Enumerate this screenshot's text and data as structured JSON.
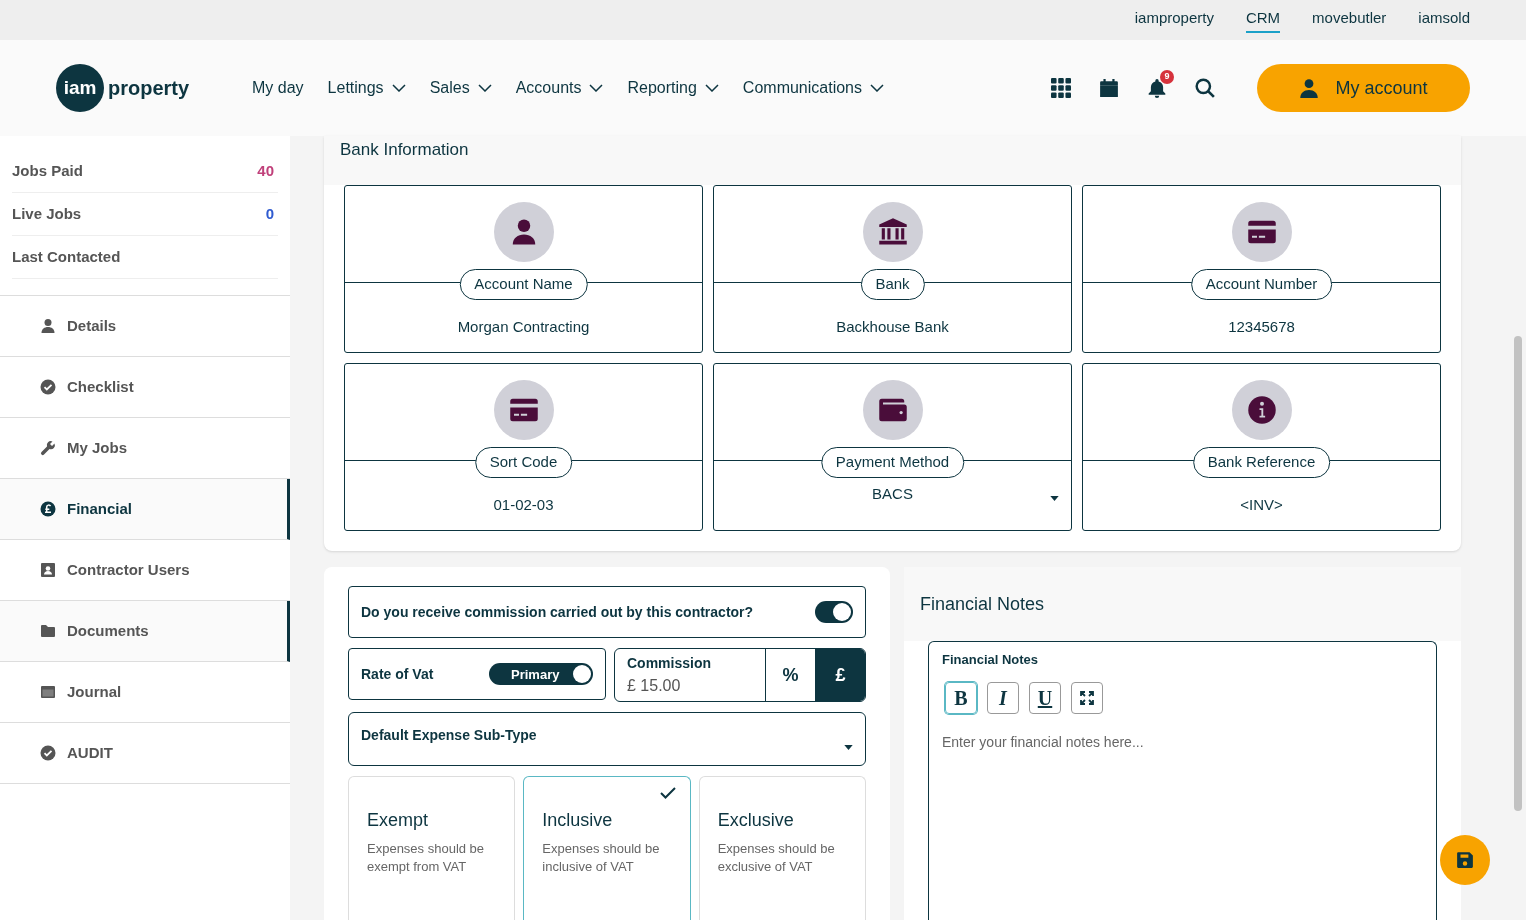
{
  "top_links": [
    {
      "label": "iamproperty",
      "selected": false
    },
    {
      "label": "CRM",
      "selected": true
    },
    {
      "label": "movebutler",
      "selected": false
    },
    {
      "label": "iamsold",
      "selected": false
    }
  ],
  "logo": {
    "mark": "iam",
    "word": "property"
  },
  "nav": [
    {
      "label": "My day",
      "has_menu": false
    },
    {
      "label": "Lettings",
      "has_menu": true
    },
    {
      "label": "Sales",
      "has_menu": true
    },
    {
      "label": "Accounts",
      "has_menu": true
    },
    {
      "label": "Reporting",
      "has_menu": true
    },
    {
      "label": "Communications",
      "has_menu": true
    }
  ],
  "notification_count": "9",
  "account_button": "My account",
  "stats": [
    {
      "label": "Jobs Paid",
      "value": "40",
      "color": "#c0407a"
    },
    {
      "label": "Live Jobs",
      "value": "0",
      "color": "#2f5bd0"
    },
    {
      "label": "Last Contacted"
    }
  ],
  "sidebar": [
    {
      "label": "Details",
      "kind": "person",
      "selected": false,
      "highlighted": false
    },
    {
      "label": "Checklist",
      "kind": "check",
      "selected": false,
      "highlighted": false
    },
    {
      "label": "My Jobs",
      "kind": "wrench",
      "selected": false,
      "highlighted": false
    },
    {
      "label": "Financial",
      "kind": "pound",
      "selected": true,
      "highlighted": true
    },
    {
      "label": "Contractor Users",
      "kind": "badge",
      "selected": false,
      "highlighted": false
    },
    {
      "label": "Documents",
      "kind": "folder",
      "selected": false,
      "highlighted": true
    },
    {
      "label": "Journal",
      "kind": "window",
      "selected": false,
      "highlighted": false
    },
    {
      "label": "AUDIT",
      "kind": "check",
      "selected": false,
      "highlighted": false
    }
  ],
  "bank": {
    "title": "Bank Information",
    "fields": [
      {
        "label": "Account Name",
        "value": "Morgan Contracting",
        "kind": "text"
      },
      {
        "label": "Bank",
        "value": "Backhouse Bank",
        "kind": "text"
      },
      {
        "label": "Account Number",
        "value": "12345678",
        "kind": "text"
      },
      {
        "label": "Sort Code",
        "value": "01-02-03",
        "kind": "text"
      },
      {
        "label": "Payment Method",
        "value": "BACS",
        "kind": "select"
      },
      {
        "label": "Bank Reference",
        "value": "<INV>",
        "kind": "text"
      }
    ]
  },
  "commission_question": {
    "label": "Do you receive commission carried out by this contractor?",
    "on": true
  },
  "vat_rate": {
    "label": "Rate of Vat",
    "toggle_label": "Primary",
    "on": true
  },
  "commission": {
    "label": "Commission",
    "value": "£ 15.00",
    "units": [
      {
        "label": "%",
        "selected": false
      },
      {
        "label": "£",
        "selected": true
      }
    ]
  },
  "expense_subtype": {
    "label": "Default Expense Sub-Type"
  },
  "vat_options": [
    {
      "title": "Exempt",
      "description": "Expenses should be exempt from VAT",
      "selected": false
    },
    {
      "title": "Inclusive",
      "description": "Expenses should be inclusive of VAT",
      "selected": true
    },
    {
      "title": "Exclusive",
      "description": "Expenses should be exclusive of VAT",
      "selected": false
    }
  ],
  "notes": {
    "title": "Financial Notes",
    "field_label": "Financial Notes",
    "placeholder": "Enter your financial notes here...",
    "tools": [
      {
        "kind": "bold",
        "label": "B",
        "selected": true
      },
      {
        "kind": "italic",
        "label": "I",
        "selected": false
      },
      {
        "kind": "underline",
        "label": "U",
        "selected": false
      },
      {
        "kind": "expand",
        "selected": false
      }
    ]
  }
}
